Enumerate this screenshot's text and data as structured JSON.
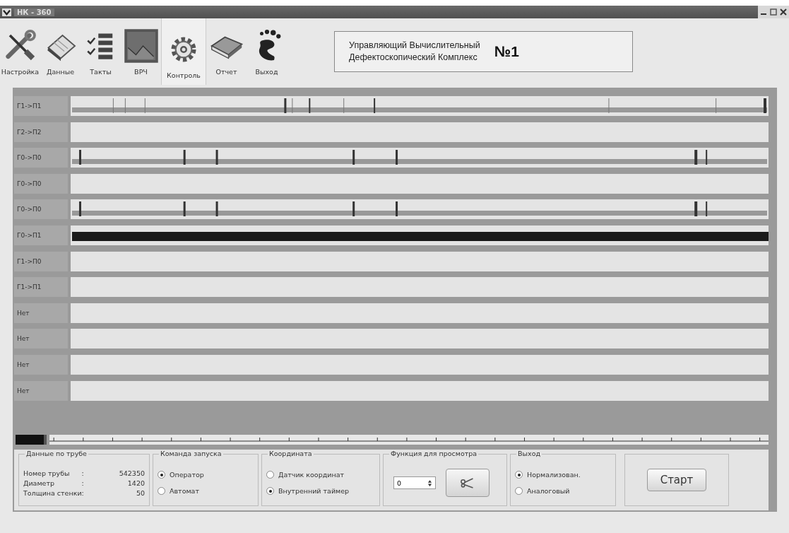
{
  "window": {
    "title": "НК - 360"
  },
  "toolbar": [
    {
      "label": "Настройка",
      "selected": false
    },
    {
      "label": "Данные",
      "selected": false
    },
    {
      "label": "Такты",
      "selected": false
    },
    {
      "label": "ВРЧ",
      "selected": false
    },
    {
      "label": "Контроль",
      "selected": true
    },
    {
      "label": "Отчет",
      "selected": false
    },
    {
      "label": "Выход",
      "selected": false
    }
  ],
  "title_box": {
    "line_1": "Управляющий Вычислительный",
    "line_2": "Дефектоскопический Комплекс",
    "number": "№1"
  },
  "channels": [
    {
      "label": "Г1->П1",
      "kind": "sparse"
    },
    {
      "label": "Г2->П2",
      "kind": "empty"
    },
    {
      "label": "Г0->П0",
      "kind": "pulses"
    },
    {
      "label": "Г0->П0",
      "kind": "empty"
    },
    {
      "label": "Г0->П0",
      "kind": "pulses"
    },
    {
      "label": "Г0->П1",
      "kind": "solid"
    },
    {
      "label": "Г1->П0",
      "kind": "empty"
    },
    {
      "label": "Г1->П1",
      "kind": "empty"
    },
    {
      "label": "Нет",
      "kind": "empty"
    },
    {
      "label": "Нет",
      "kind": "empty"
    },
    {
      "label": "Нет",
      "kind": "empty"
    },
    {
      "label": "Нет",
      "kind": "empty"
    }
  ],
  "pipe_data": {
    "title": "Данные по трубе",
    "rows": [
      {
        "label": "Номер трубы",
        "separator": ":",
        "value": "542350"
      },
      {
        "label": "Диаметр",
        "separator": ":",
        "value": "1420"
      },
      {
        "label": "Толщина стенки",
        "separator": ":",
        "value": "50"
      }
    ]
  },
  "launch_command": {
    "title": "Команда запуска",
    "options": [
      {
        "label": "Оператор",
        "selected": true
      },
      {
        "label": "Автомат",
        "selected": false
      }
    ]
  },
  "coordinate": {
    "title": "Координата",
    "options": [
      {
        "label": "Датчик координат",
        "selected": false
      },
      {
        "label": "Внутренний таймер",
        "selected": true
      }
    ]
  },
  "view_function": {
    "title": "Функция для просмотра",
    "value": "0"
  },
  "output": {
    "title": "Выход",
    "options": [
      {
        "label": "Нормализован.",
        "selected": true
      },
      {
        "label": "Аналоговый",
        "selected": false
      }
    ]
  },
  "start_button": "Старт"
}
